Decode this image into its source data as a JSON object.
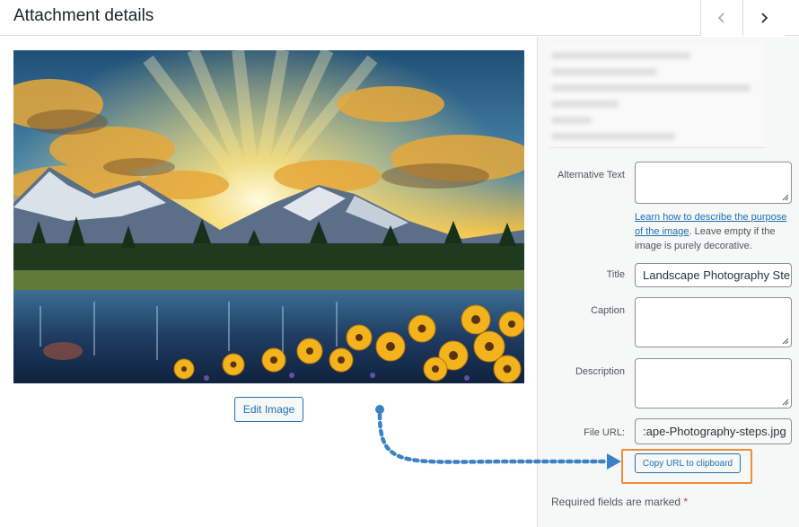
{
  "header": {
    "title": "Attachment details"
  },
  "media": {
    "edit_image_label": "Edit Image"
  },
  "form": {
    "alt_text": {
      "label": "Alternative Text",
      "value": ""
    },
    "alt_help": {
      "link_text": "Learn how to describe the purpose of the image",
      "suffix": ". Leave empty if the image is purely decorative."
    },
    "title": {
      "label": "Title",
      "value": "Landscape Photography Ste"
    },
    "caption": {
      "label": "Caption",
      "value": ""
    },
    "description": {
      "label": "Description",
      "value": ""
    },
    "file_url": {
      "label": "File URL:",
      "value": ":ape-Photography-steps.jpg"
    },
    "copy_url_label": "Copy URL to clipboard",
    "required_note": "Required fields are marked",
    "required_star": "*"
  },
  "colors": {
    "accent": "#2271b1",
    "highlight": "#f08c3a",
    "required": "#d63638"
  }
}
